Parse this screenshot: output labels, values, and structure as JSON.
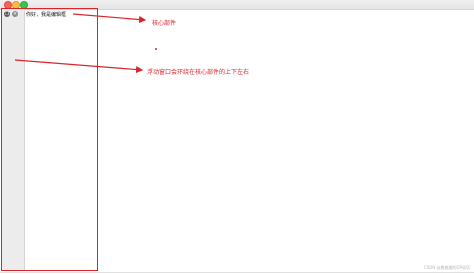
{
  "window": {
    "controls": [
      "close",
      "minimize",
      "zoom"
    ]
  },
  "dock": {
    "float_icon": "restore-icon",
    "close_icon": "close-icon",
    "editor_text": "你好，我是编辑框"
  },
  "annotations": {
    "core_label": "核心部件",
    "dock_label": "浮动窗口会环绕在核心部件的上下左右"
  },
  "watermark": "CSDN @靠着蹦的DP说话",
  "colors": {
    "annotation": "#d9262c"
  }
}
